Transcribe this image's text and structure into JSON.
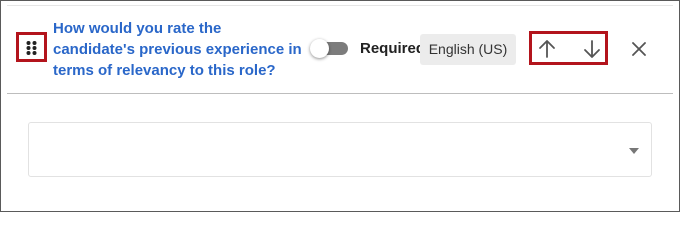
{
  "question": {
    "text": "How would you rate the candidate's previous experience in terms of relevancy to this role?"
  },
  "required_toggle": {
    "label": "Required",
    "on": false
  },
  "language": {
    "value": "English (US)"
  },
  "icons": {
    "drag": "drag-handle-icon",
    "move_up": "arrow-up-icon",
    "move_down": "arrow-down-icon",
    "remove": "close-icon",
    "dropdown": "caret-down-icon"
  },
  "answer_select": {
    "value": ""
  },
  "colors": {
    "question_text": "#2a67c9",
    "highlight_outline": "#b3141c",
    "toggle_off": "#7c7c7c",
    "badge_bg": "#ececec"
  }
}
